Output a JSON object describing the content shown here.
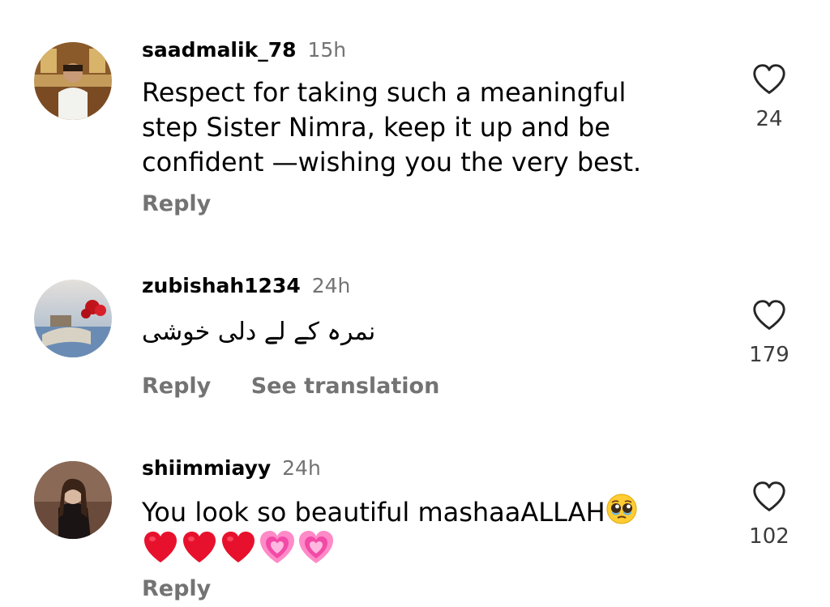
{
  "comments": [
    {
      "username": "saadmalik_78",
      "time": "15h",
      "text_lines": [
        "Respect for taking such a meaningful",
        "step  Sister Nimra, keep it up and be",
        "confident —wishing you the very best."
      ],
      "reply_label": "Reply",
      "like_count": "24"
    },
    {
      "username": "zubishah1234",
      "time": "24h",
      "text_lines": [
        "نمرہ کے لے دلی خوشی"
      ],
      "reply_label": "Reply",
      "see_translation_label": "See translation",
      "like_count": "179"
    },
    {
      "username": "shiimmiayy",
      "time": "24h",
      "text_lines": [
        "You look so beautiful mashaaALLAH"
      ],
      "emojis_inline": [
        "pleading-face-emoji"
      ],
      "emoji_line": [
        "red-heart-emoji",
        "red-heart-emoji",
        "red-heart-emoji",
        "growing-heart-emoji",
        "growing-heart-emoji"
      ],
      "reply_label": "Reply",
      "like_count": "102"
    }
  ],
  "colors": {
    "username": "#000000",
    "secondary_text": "#737373",
    "like_count": "#3c3c3c",
    "heart_outline": "#262626"
  },
  "icons": {
    "like": "heart-outline-icon"
  }
}
